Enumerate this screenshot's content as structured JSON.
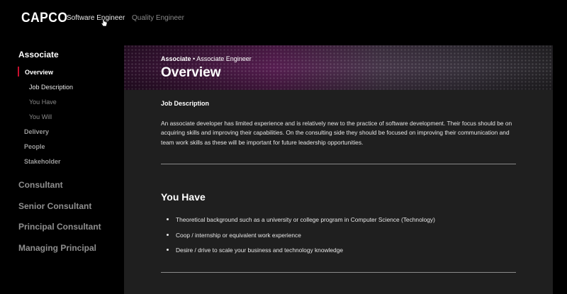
{
  "brand": {
    "logo": "CAPCO"
  },
  "top_nav": {
    "tabs": [
      {
        "label": "Software Engineer",
        "active": true
      },
      {
        "label": "Quality Engineer",
        "active": false
      }
    ]
  },
  "sidebar": {
    "section": "Associate",
    "items": [
      {
        "label": "Overview"
      },
      {
        "label": "Job Description"
      },
      {
        "label": "You Have"
      },
      {
        "label": "You Will"
      },
      {
        "label": "Delivery"
      },
      {
        "label": "People"
      },
      {
        "label": "Stakeholder"
      }
    ],
    "levels": [
      {
        "label": "Consultant"
      },
      {
        "label": "Senior Consultant"
      },
      {
        "label": "Principal Consultant"
      },
      {
        "label": "Managing Principal"
      }
    ]
  },
  "hero": {
    "crumb_level": "Associate",
    "crumb_sep": " • ",
    "crumb_role": "Associate Engineer",
    "title": "Overview"
  },
  "job_description": {
    "heading": "Job Description",
    "body": "An associate developer has limited experience and is relatively new to the practice of software development. Their focus should be on acquiring skills and improving their capabilities. On the consulting side they should be focused on improving their communication and team work skills as these will be important for future leadership opportunities."
  },
  "you_have": {
    "heading": "You Have",
    "bullets": [
      "Theoretical background such as a university or college program in Computer Science (Technology)",
      "Coop / internship or equivalent work experience",
      "Desire / drive to scale your business and technology knowledge"
    ]
  },
  "colors": {
    "accent": "#c8102e",
    "page_bg": "#000000",
    "content_bg": "#1f1f1f"
  }
}
